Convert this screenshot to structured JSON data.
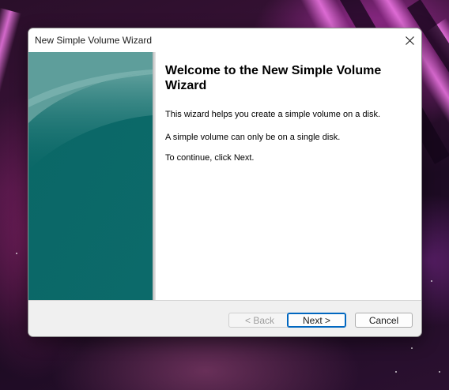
{
  "window": {
    "title": "New Simple Volume Wizard",
    "close_icon": "close-icon"
  },
  "content": {
    "heading": "Welcome to the New Simple Volume Wizard",
    "paragraph_1": "This wizard helps you create a simple volume on a disk.",
    "paragraph_2": "A simple volume can only be on a single disk.",
    "paragraph_3": "To continue, click Next."
  },
  "buttons": {
    "back": "< Back",
    "next": "Next >",
    "cancel": "Cancel"
  },
  "colors": {
    "banner": "#16716f",
    "accent": "#0067c0",
    "footer": "#f0f0f0"
  }
}
